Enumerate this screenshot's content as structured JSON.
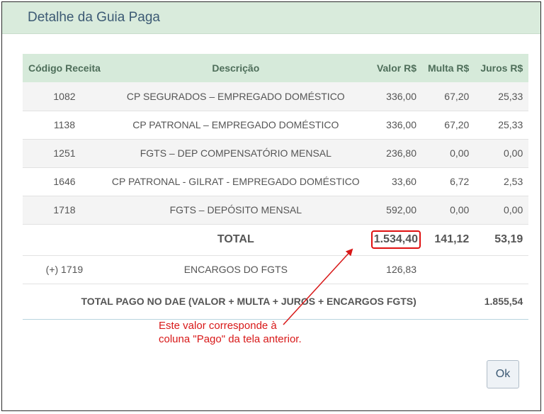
{
  "dialog": {
    "title": "Detalhe da Guia Paga"
  },
  "table": {
    "headers": {
      "codigo": "Código Receita",
      "descricao": "Descrição",
      "valor": "Valor R$",
      "multa": "Multa R$",
      "juros": "Juros R$"
    },
    "rows": [
      {
        "codigo": "1082",
        "descricao": "CP SEGURADOS – EMPREGADO DOMÉSTICO",
        "valor": "336,00",
        "multa": "67,20",
        "juros": "25,33"
      },
      {
        "codigo": "1138",
        "descricao": "CP PATRONAL – EMPREGADO DOMÉSTICO",
        "valor": "336,00",
        "multa": "67,20",
        "juros": "25,33"
      },
      {
        "codigo": "1251",
        "descricao": "FGTS – DEP COMPENSATÓRIO MENSAL",
        "valor": "236,80",
        "multa": "0,00",
        "juros": "0,00"
      },
      {
        "codigo": "1646",
        "descricao": "CP PATRONAL - GILRAT - EMPREGADO DOMÉSTICO",
        "valor": "33,60",
        "multa": "6,72",
        "juros": "2,53"
      },
      {
        "codigo": "1718",
        "descricao": "FGTS – DEPÓSITO MENSAL",
        "valor": "592,00",
        "multa": "0,00",
        "juros": "0,00"
      }
    ],
    "total": {
      "label": "TOTAL",
      "valor": "1.534,40",
      "multa": "141,12",
      "juros": "53,19"
    },
    "encargos": {
      "codigo": "(+) 1719",
      "descricao": "ENCARGOS DO FGTS",
      "valor": "126,83"
    },
    "pago": {
      "label": "TOTAL PAGO NO DAE (VALOR + MULTA + JUROS + ENCARGOS FGTS)",
      "valor": "1.855,54"
    }
  },
  "annotation": {
    "line1": "Este valor corresponde à",
    "line2": "coluna \"Pago\" da tela anterior.",
    "color": "#d81818"
  },
  "buttons": {
    "ok": "Ok"
  }
}
